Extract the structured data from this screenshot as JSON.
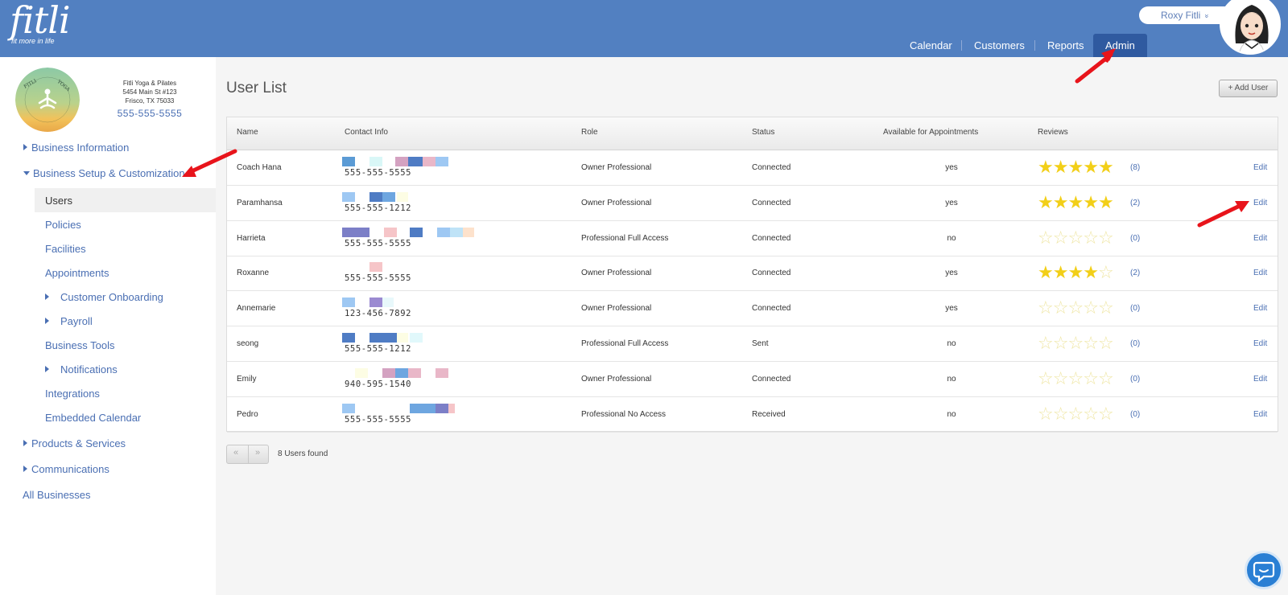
{
  "brand": {
    "logo_text": "fitli",
    "tagline": "fit more in life"
  },
  "header": {
    "user_name": "Roxy Fitli",
    "user_chevron": "»",
    "nav": [
      {
        "label": "Calendar"
      },
      {
        "label": "Customers"
      },
      {
        "label": "Reports"
      },
      {
        "label": "Admin",
        "active": true
      }
    ]
  },
  "business": {
    "logo_text": "FITLI YOGA & PILATES",
    "name": "Fitli Yoga & Pilates",
    "address1": "5454 Main St #123",
    "address2": "Frisco, TX 75033",
    "phone": "555-555-5555"
  },
  "sidebar": {
    "items": [
      {
        "label": "Business Information"
      },
      {
        "label": "Business Setup & Customization"
      },
      {
        "label": "Users"
      },
      {
        "label": "Policies"
      },
      {
        "label": "Facilities"
      },
      {
        "label": "Appointments"
      },
      {
        "label": "Customer Onboarding"
      },
      {
        "label": "Payroll"
      },
      {
        "label": "Business Tools"
      },
      {
        "label": "Notifications"
      },
      {
        "label": "Integrations"
      },
      {
        "label": "Embedded Calendar"
      },
      {
        "label": "Products & Services"
      },
      {
        "label": "Communications"
      },
      {
        "label": "All Businesses"
      }
    ]
  },
  "main": {
    "title": "User List",
    "add_button": "+ Add User",
    "columns": [
      "Name",
      "Contact Info",
      "Role",
      "Status",
      "Available for Appointments",
      "Reviews"
    ],
    "rows": [
      {
        "name": "Coach Hana",
        "phone": "555-555-5555",
        "role": "Owner Professional",
        "status": "Connected",
        "available": "yes",
        "rating": 5,
        "count": "(8)",
        "edit": "Edit"
      },
      {
        "name": "Paramhansa",
        "phone": "555-555-1212",
        "role": "Owner Professional",
        "status": "Connected",
        "available": "yes",
        "rating": 5,
        "count": "(2)",
        "edit": "Edit"
      },
      {
        "name": "Harrieta",
        "phone": "555-555-5555",
        "role": "Professional Full Access",
        "status": "Connected",
        "available": "no",
        "rating": 0,
        "count": "(0)",
        "edit": "Edit"
      },
      {
        "name": "Roxanne",
        "phone": "555-555-5555",
        "role": "Owner Professional",
        "status": "Connected",
        "available": "yes",
        "rating": 4,
        "count": "(2)",
        "edit": "Edit"
      },
      {
        "name": "Annemarie",
        "phone": "123-456-7892",
        "role": "Owner Professional",
        "status": "Connected",
        "available": "yes",
        "rating": 0,
        "count": "(0)",
        "edit": "Edit"
      },
      {
        "name": "seong",
        "phone": "555-555-1212",
        "role": "Professional Full Access",
        "status": "Sent",
        "available": "no",
        "rating": 0,
        "count": "(0)",
        "edit": "Edit"
      },
      {
        "name": "Emily",
        "phone": "940-595-1540",
        "role": "Owner Professional",
        "status": "Connected",
        "available": "no",
        "rating": 0,
        "count": "(0)",
        "edit": "Edit"
      },
      {
        "name": "Pedro",
        "phone": "555-555-5555",
        "role": "Professional No Access",
        "status": "Received",
        "available": "no",
        "rating": 0,
        "count": "(0)",
        "edit": "Edit"
      }
    ],
    "pager_prev": "«",
    "pager_next": "»",
    "found_text": "8 Users found"
  },
  "colors": {
    "header_bg": "#5280c1",
    "nav_active_bg": "#2f5aa0",
    "link": "#4a6fb3",
    "star_on": "#f2cf18",
    "star_off": "#efe6a4",
    "annotation_arrow": "#e8141b"
  },
  "icons": {
    "chat": "chat-bubble-icon",
    "star": "star-icon"
  }
}
